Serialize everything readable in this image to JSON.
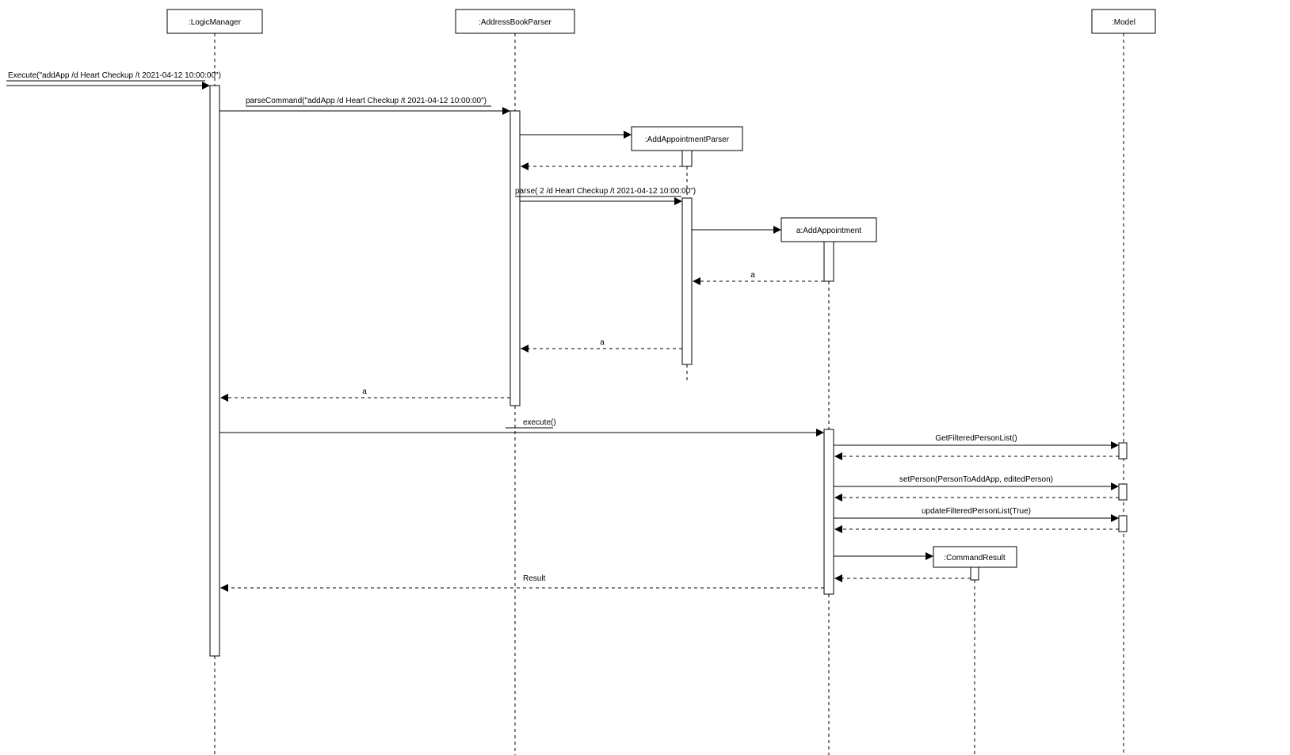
{
  "lifelines": {
    "logicManager": ":LogicManager",
    "addressBookParser": ":AddressBookParser",
    "addAppointmentParser": ":AddAppointmentParser",
    "addAppointment": "a:AddAppointment",
    "model": ":Model",
    "commandResult": ":CommandResult"
  },
  "messages": {
    "execute": "Execute(\"addApp /d Heart Checkup /t 2021-04-12 10:00:00\")",
    "parseCommand": "parseCommand(\"addApp /d Heart Checkup /t 2021-04-12 10:00:00\")",
    "parse": "parse( 2 /d Heart Checkup /t 2021-04-12 10:00:00\")",
    "return_a1": "a",
    "return_a2": "a",
    "return_a3": "a",
    "executeCall": "execute()",
    "getFiltered": "GetFilteredPersonList()",
    "setPerson": "setPerson(PersonToAddApp, editedPerson)",
    "updateFiltered": "updateFilteredPersonList(True)",
    "result": "Result"
  }
}
